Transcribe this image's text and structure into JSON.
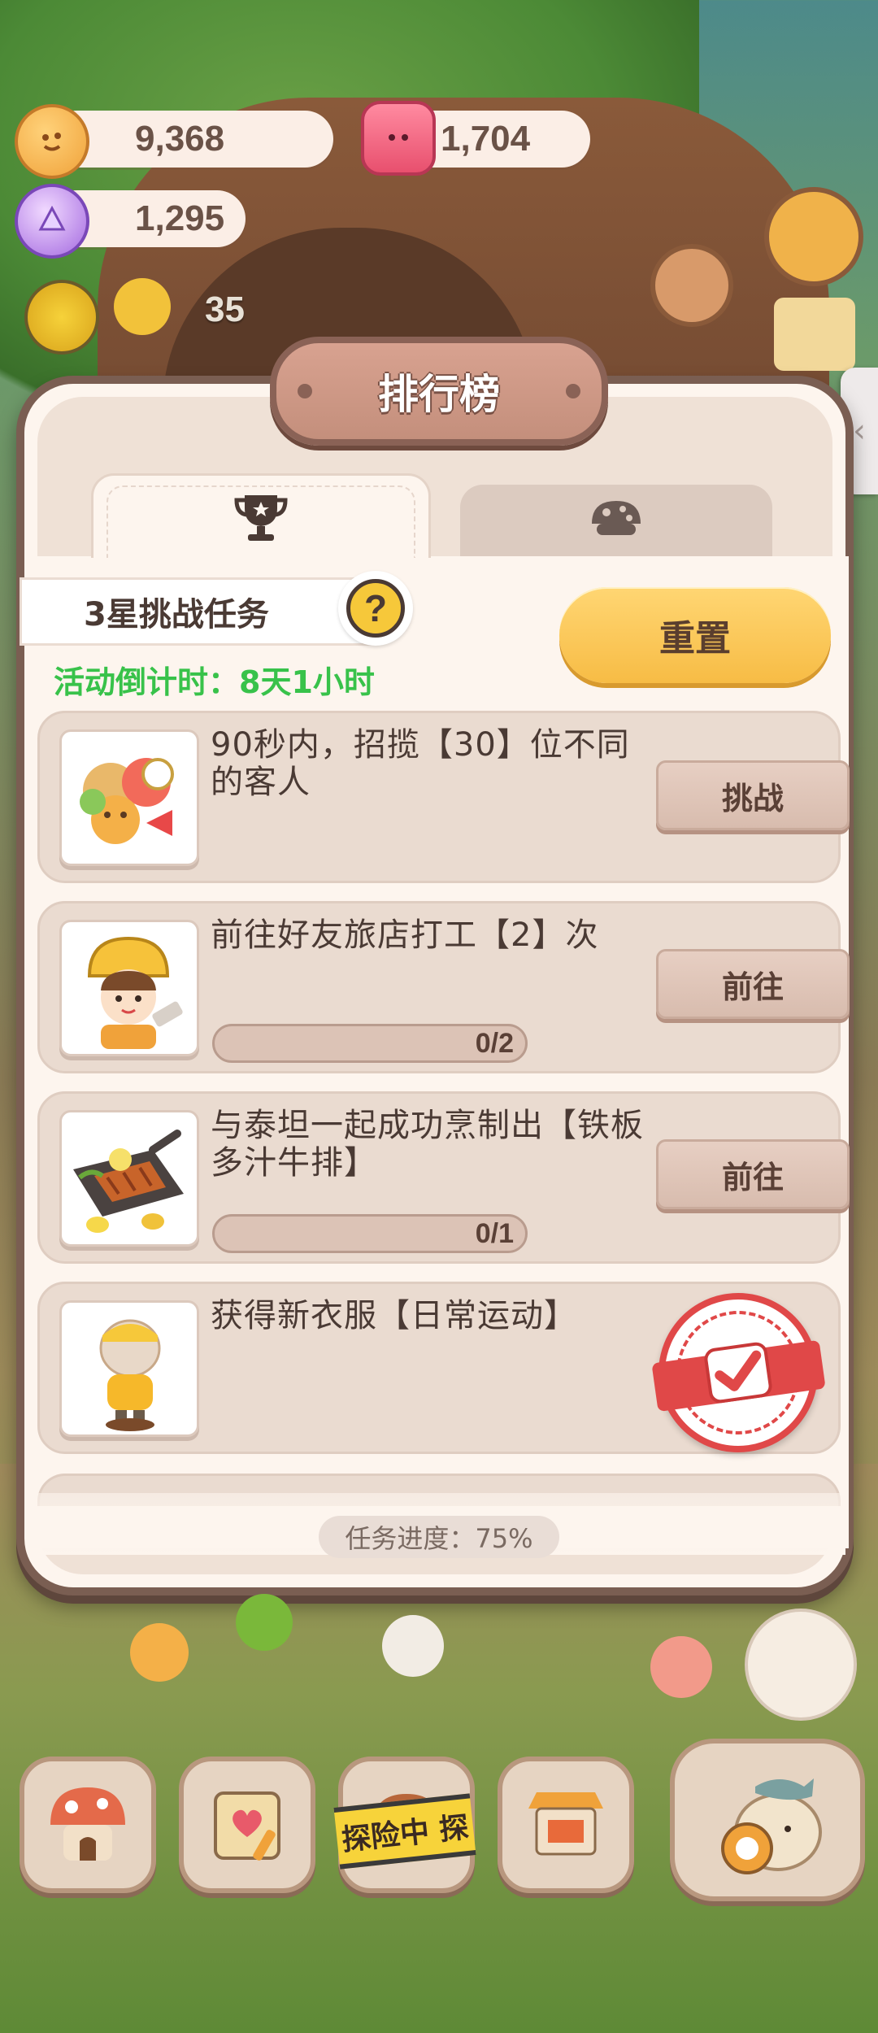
{
  "resources": {
    "coin": {
      "value": "9,368",
      "icon": "cookie-coin-icon"
    },
    "gem": {
      "value": "1,704",
      "icon": "pink-gem-icon"
    },
    "crystal": {
      "value": "1,295",
      "icon": "candy-crystal-icon"
    }
  },
  "level": {
    "value": "35",
    "icon": "sun-gear-icon"
  },
  "modal": {
    "title": "排行榜",
    "tabs": [
      {
        "id": "trophy",
        "icon": "trophy-icon",
        "active": true
      },
      {
        "id": "cookie",
        "icon": "mushroom-cookie-icon",
        "active": false
      }
    ],
    "task_type_label": "3星挑战任务",
    "help_label": "?",
    "countdown": "活动倒计时：8天1小时",
    "reset_label": "重置",
    "tasks": [
      {
        "text": "90秒内，招揽【30】位不同的客人",
        "button": "挑战",
        "progress": null
      },
      {
        "text": "前往好友旅店打工【2】次",
        "button": "前往",
        "progress": {
          "text": "0/2",
          "fraction": 0
        }
      },
      {
        "text": "与泰坦一起成功烹制出【铁板多汁牛排】",
        "button": "前往",
        "progress": {
          "text": "0/1",
          "fraction": 0
        }
      },
      {
        "text": "获得新衣服【日常运动】",
        "button": null,
        "completed": true
      }
    ],
    "footer_progress": "任务进度：75%"
  },
  "bottom_nav": {
    "explore_label": "探险中 探"
  },
  "colors": {
    "accent": "#f7bc45",
    "countdown_green": "#38c24a",
    "panel_border": "#7a5e52",
    "stamp_red": "#e04848"
  }
}
